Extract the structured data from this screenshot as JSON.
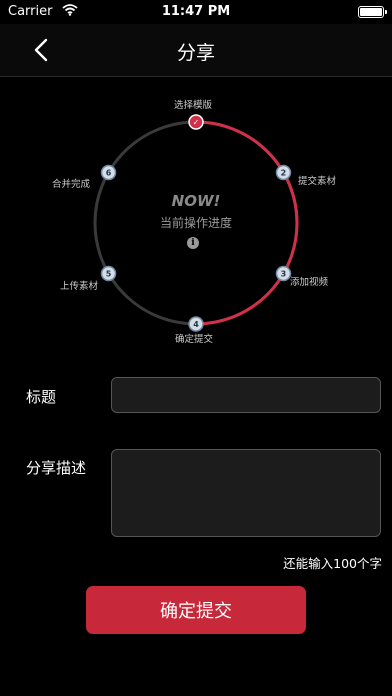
{
  "status_bar": {
    "carrier": "Carrier",
    "time": "11:47 PM",
    "battery_level": 1.0
  },
  "nav": {
    "title": "分享",
    "back_icon": "chevron-left-icon"
  },
  "progress": {
    "center_title": "NOW!",
    "center_subtitle": "当前操作进度",
    "info_icon": "info-icon",
    "active_color": "#d0304a",
    "inactive_color": "#3a3a3a",
    "steps": [
      {
        "number": "✓",
        "label": "选择模版",
        "done": true
      },
      {
        "number": "2",
        "label": "提交素材",
        "done": false
      },
      {
        "number": "3",
        "label": "添加视频",
        "done": false
      },
      {
        "number": "4",
        "label": "确定提交",
        "done": false
      },
      {
        "number": "5",
        "label": "上传素材",
        "done": false
      },
      {
        "number": "6",
        "label": "合并完成",
        "done": false
      }
    ]
  },
  "form": {
    "title_label": "标题",
    "title_value": "",
    "desc_label": "分享描述",
    "desc_value": "",
    "char_hint": "还能输入100个字",
    "submit_label": "确定提交"
  },
  "colors": {
    "background": "#000000",
    "accent": "#c7283a"
  }
}
